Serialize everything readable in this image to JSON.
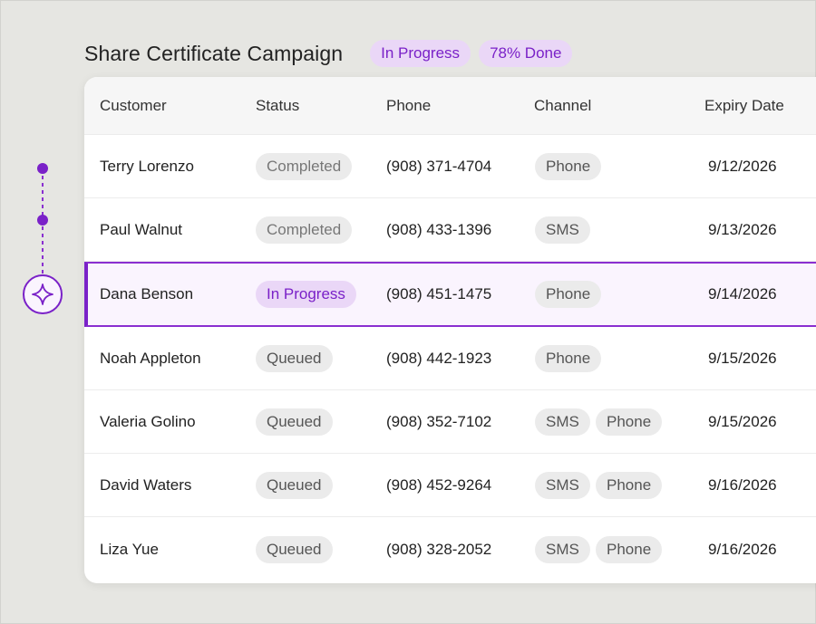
{
  "header": {
    "title": "Share Certificate Campaign",
    "badges": [
      "In Progress",
      "78% Done"
    ]
  },
  "table": {
    "columns": [
      "Customer",
      "Status",
      "Phone",
      "Channel",
      "Expiry Date"
    ],
    "rows": [
      {
        "customer": "Terry Lorenzo",
        "status": "Completed",
        "phone": "(908) 371-4704",
        "channels": [
          "Phone"
        ],
        "expiry": "9/12/2026"
      },
      {
        "customer": "Paul Walnut",
        "status": "Completed",
        "phone": "(908) 433-1396",
        "channels": [
          "SMS"
        ],
        "expiry": "9/13/2026"
      },
      {
        "customer": "Dana Benson",
        "status": "In Progress",
        "phone": "(908) 451-1475",
        "channels": [
          "Phone"
        ],
        "expiry": "9/14/2026"
      },
      {
        "customer": "Noah Appleton",
        "status": "Queued",
        "phone": "(908) 442-1923",
        "channels": [
          "Phone"
        ],
        "expiry": "9/15/2026"
      },
      {
        "customer": "Valeria Golino",
        "status": "Queued",
        "phone": "(908) 352-7102",
        "channels": [
          "SMS",
          "Phone"
        ],
        "expiry": "9/15/2026"
      },
      {
        "customer": "David Waters",
        "status": "Queued",
        "phone": "(908) 452-9264",
        "channels": [
          "SMS",
          "Phone"
        ],
        "expiry": "9/16/2026"
      },
      {
        "customer": "Liza Yue",
        "status": "Queued",
        "phone": "(908) 328-2052",
        "channels": [
          "SMS",
          "Phone"
        ],
        "expiry": "9/16/2026"
      }
    ]
  },
  "icons": {
    "timeline_current": "sparkle-icon"
  },
  "colors": {
    "accent": "#7a21c8",
    "accent_light": "#ead7f7",
    "background": "#e6e6e2"
  }
}
